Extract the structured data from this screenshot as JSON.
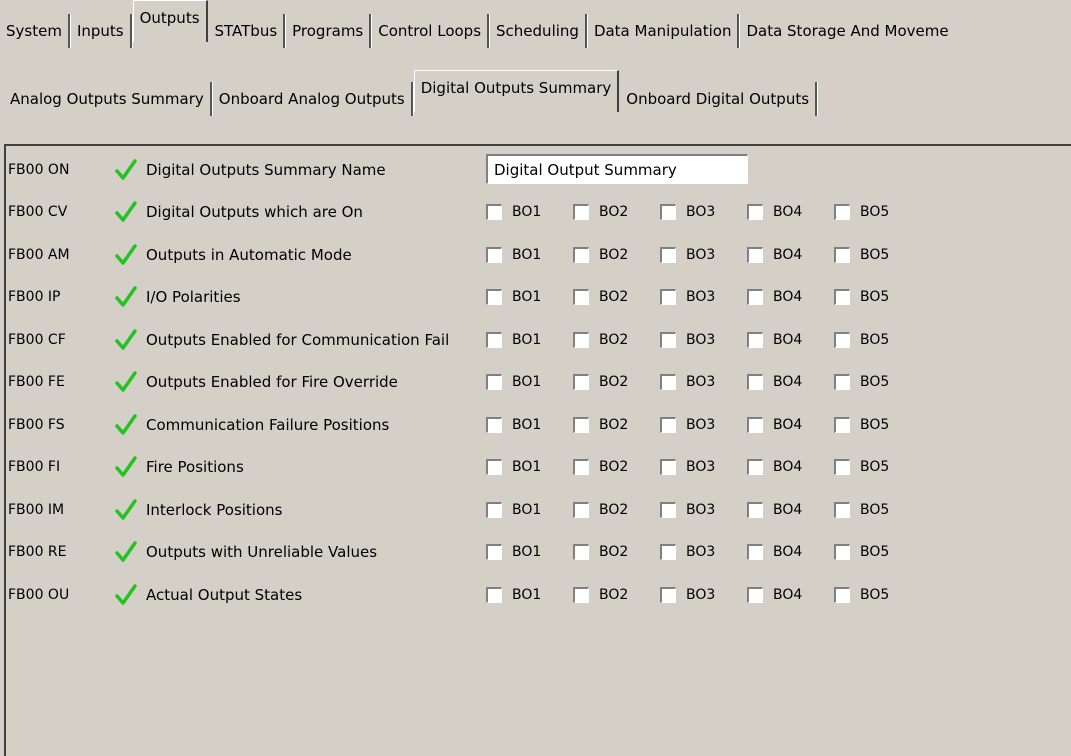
{
  "top_tabs": [
    "System",
    "Inputs",
    "Outputs",
    "STATbus",
    "Programs",
    "Control Loops",
    "Scheduling",
    "Data Manipulation",
    "Data Storage And Moveme"
  ],
  "top_active": "Outputs",
  "sub_tabs": [
    "Analog Outputs Summary",
    "Onboard Analog Outputs",
    "Digital Outputs Summary",
    "Onboard Digital Outputs"
  ],
  "sub_active": "Digital Outputs Summary",
  "name_row": {
    "code": "FB00 ON",
    "label": "Digital Outputs Summary Name",
    "value": "Digital Output Summary"
  },
  "bo_labels": [
    "BO1",
    "BO2",
    "BO3",
    "BO4",
    "BO5"
  ],
  "rows": [
    {
      "code": "FB00 CV",
      "label": "Digital Outputs which are On"
    },
    {
      "code": "FB00 AM",
      "label": "Outputs in Automatic Mode"
    },
    {
      "code": "FB00 IP",
      "label": "I/O Polarities"
    },
    {
      "code": "FB00 CF",
      "label": "Outputs Enabled for Communication Fail"
    },
    {
      "code": "FB00 FE",
      "label": "Outputs Enabled for Fire Override"
    },
    {
      "code": "FB00 FS",
      "label": "Communication Failure Positions"
    },
    {
      "code": "FB00 FI",
      "label": "Fire Positions"
    },
    {
      "code": "FB00 IM",
      "label": "Interlock Positions"
    },
    {
      "code": "FB00 RE",
      "label": "Outputs with Unreliable Values"
    },
    {
      "code": "FB00 OU",
      "label": "Actual Output States"
    }
  ],
  "colors": {
    "check": "#22c322",
    "background": "#d4d0c8"
  }
}
